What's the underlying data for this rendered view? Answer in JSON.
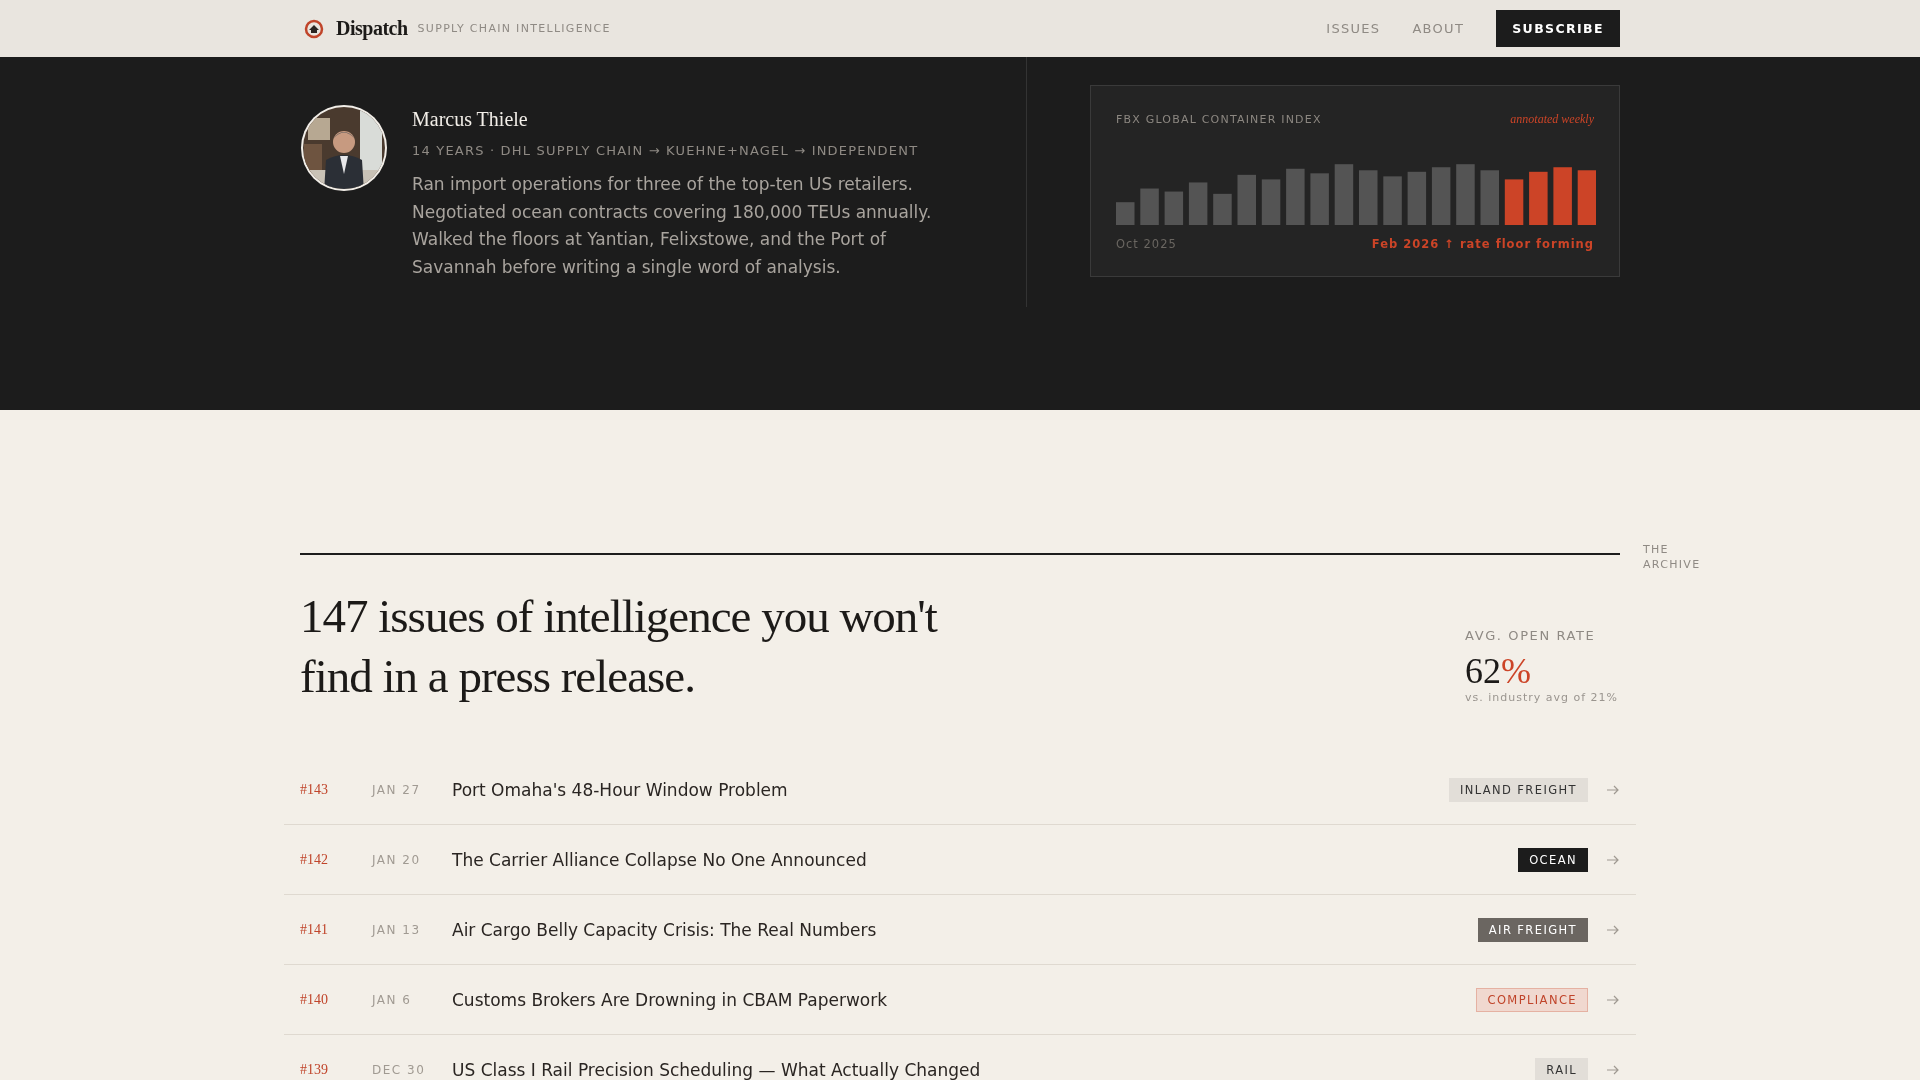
{
  "header": {
    "brand": "Dispatch",
    "tagline": "SUPPLY CHAIN INTELLIGENCE",
    "nav": [
      {
        "label": "ISSUES"
      },
      {
        "label": "ABOUT"
      }
    ],
    "cta": "SUBSCRIBE"
  },
  "author": {
    "name": "Marcus Thiele",
    "career": "14 YEARS · DHL SUPPLY CHAIN → KUEHNE+NAGEL → INDEPENDENT",
    "bio": "Ran import operations for three of the top-ten US retailers. Negotiated ocean contracts covering 180,000 TEUs annually. Walked the floors at Yantian, Felixstowe, and the Port of Savannah before writing a single word of analysis."
  },
  "chart_card": {
    "title": "FBX GLOBAL CONTAINER INDEX",
    "note": "annotated weekly",
    "start_label": "Oct 2025",
    "end_label": "Feb 2026 ↑ rate floor forming"
  },
  "archive": {
    "eyebrow": "THE ARCHIVE",
    "heading": "147 issues of intelligence you won't find in a press release.",
    "stat_label": "AVG. OPEN RATE",
    "stat_value": "62",
    "stat_unit": "%",
    "stat_note": "vs. industry avg of 21%"
  },
  "issues": [
    {
      "number": "#143",
      "date": "JAN 27",
      "title": "Port Omaha's 48-Hour Window Problem",
      "tag": "INLAND FREIGHT",
      "kind": "light"
    },
    {
      "number": "#142",
      "date": "JAN 20",
      "title": "The Carrier Alliance Collapse No One Announced",
      "tag": "OCEAN",
      "kind": "dark"
    },
    {
      "number": "#141",
      "date": "JAN 13",
      "title": "Air Cargo Belly Capacity Crisis: The Real Numbers",
      "tag": "AIR FREIGHT",
      "kind": "grey"
    },
    {
      "number": "#140",
      "date": "JAN 6",
      "title": "Customs Brokers Are Drowning in CBAM Paperwork",
      "tag": "COMPLIANCE",
      "kind": "alert"
    },
    {
      "number": "#139",
      "date": "DEC 30",
      "title": "US Class I Rail Precision Scheduling — What Actually Changed",
      "tag": "RAIL",
      "kind": "light"
    }
  ]
}
